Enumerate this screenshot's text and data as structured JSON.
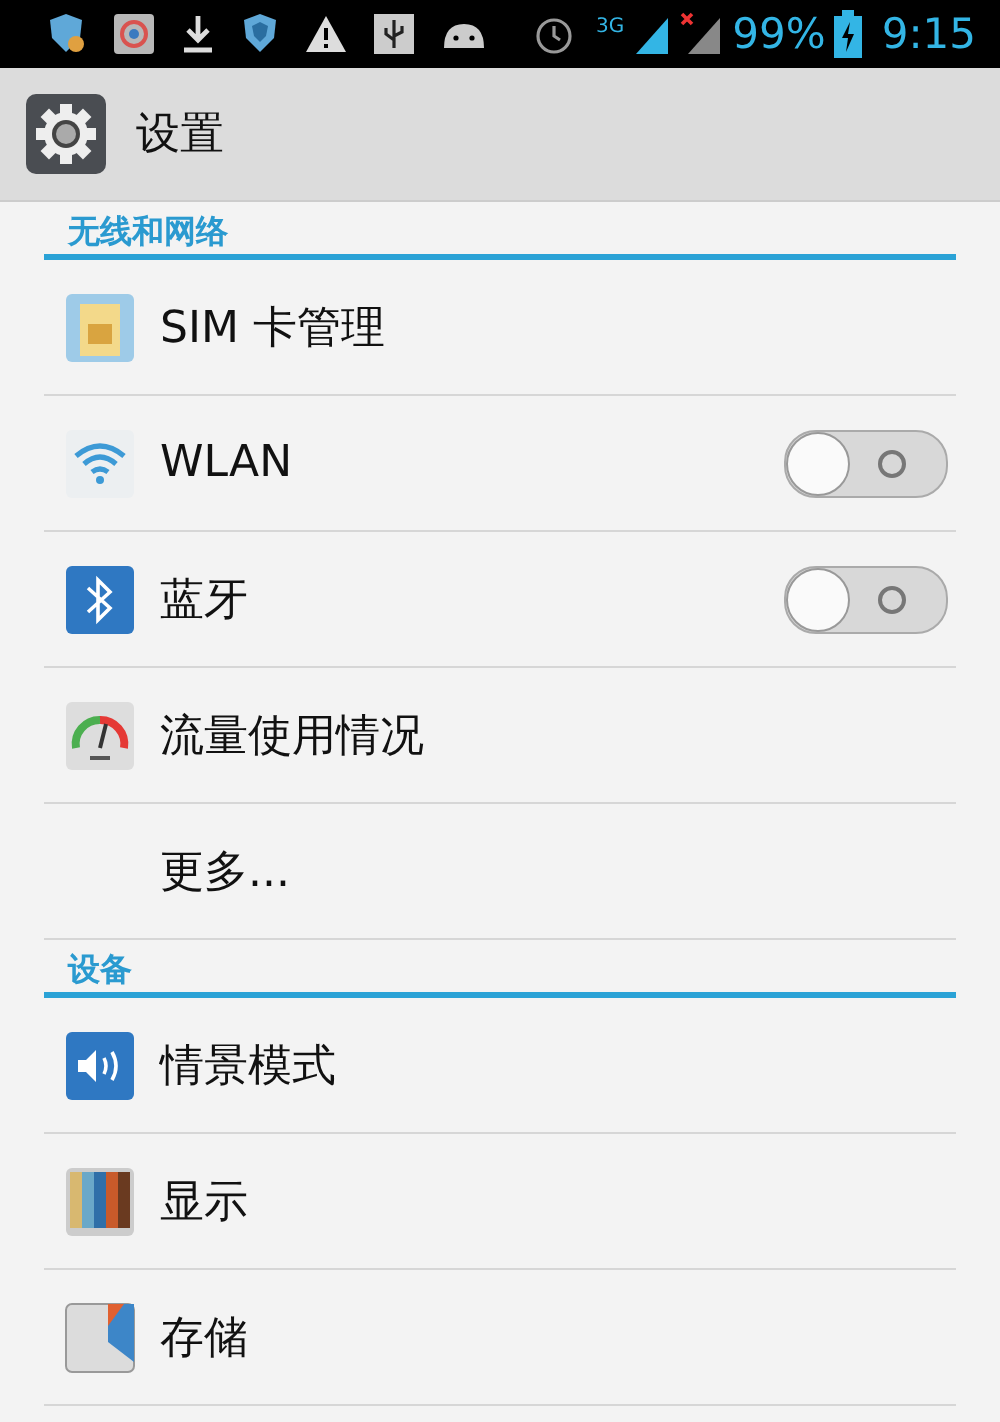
{
  "status_bar": {
    "network": "3G",
    "battery": "99%",
    "time": "9:15"
  },
  "app_bar": {
    "title": "设置"
  },
  "sections": [
    {
      "title": "无线和网络",
      "items": [
        {
          "label": "SIM 卡管理",
          "kind": "plain"
        },
        {
          "label": "WLAN",
          "kind": "toggle",
          "on": false
        },
        {
          "label": "蓝牙",
          "kind": "toggle",
          "on": false
        },
        {
          "label": "流量使用情况",
          "kind": "plain"
        },
        {
          "label": "更多...",
          "kind": "plain"
        }
      ]
    },
    {
      "title": "设备",
      "items": [
        {
          "label": "情景模式",
          "kind": "plain"
        },
        {
          "label": "显示",
          "kind": "plain"
        },
        {
          "label": "存储",
          "kind": "plain"
        }
      ]
    }
  ]
}
